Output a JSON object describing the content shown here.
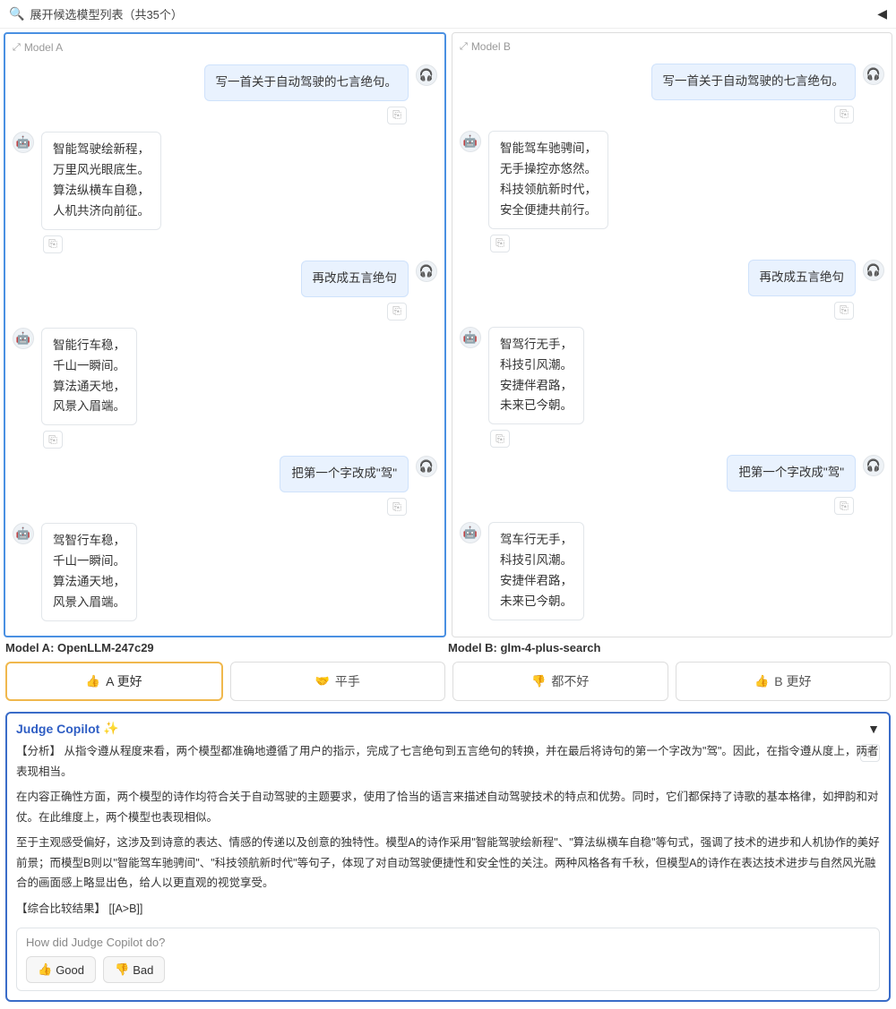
{
  "top": {
    "text": "展开候选模型列表（共35个）"
  },
  "panels": {
    "a": {
      "head": "Model A",
      "turns": [
        {
          "role": "user",
          "text": "写一首关于自动驾驶的七言绝句。"
        },
        {
          "role": "bot",
          "lines": [
            "智能驾驶绘新程，",
            "万里风光眼底生。",
            "算法纵横车自稳，",
            "人机共济向前征。"
          ]
        },
        {
          "role": "user",
          "text": "再改成五言绝句"
        },
        {
          "role": "bot",
          "lines": [
            "智能行车稳，",
            "千山一瞬间。",
            "算法通天地，",
            "风景入眉端。"
          ]
        },
        {
          "role": "user",
          "text": "把第一个字改成\"驾\""
        },
        {
          "role": "bot",
          "lines": [
            "驾智行车稳，",
            "千山一瞬间。",
            "算法通天地，",
            "风景入眉端。"
          ]
        }
      ]
    },
    "b": {
      "head": "Model B",
      "turns": [
        {
          "role": "user",
          "text": "写一首关于自动驾驶的七言绝句。"
        },
        {
          "role": "bot",
          "lines": [
            "智能驾车驰骋间，",
            "无手操控亦悠然。",
            "科技领航新时代，",
            "安全便捷共前行。"
          ]
        },
        {
          "role": "user",
          "text": "再改成五言绝句"
        },
        {
          "role": "bot",
          "lines": [
            "智驾行无手，",
            "科技引风潮。",
            "安捷伴君路，",
            "未来已今朝。"
          ]
        },
        {
          "role": "user",
          "text": "把第一个字改成\"驾\""
        },
        {
          "role": "bot",
          "lines": [
            "驾车行无手，",
            "科技引风潮。",
            "安捷伴君路，",
            "未来已今朝。"
          ]
        }
      ]
    }
  },
  "model_labels": {
    "a": "Model A: OpenLLM-247c29",
    "b": "Model B: glm-4-plus-search"
  },
  "votes": {
    "a_better": "A 更好",
    "tie": "平手",
    "both_bad": "都不好",
    "b_better": "B 更好"
  },
  "judge": {
    "title": "Judge Copilot",
    "analysis_label": "【分析】",
    "analysis_p1": "从指令遵从程度来看，两个模型都准确地遵循了用户的指示，完成了七言绝句到五言绝句的转换，并在最后将诗句的第一个字改为\"驾\"。因此，在指令遵从度上，两者表现相当。",
    "analysis_p2": "在内容正确性方面，两个模型的诗作均符合关于自动驾驶的主题要求，使用了恰当的语言来描述自动驾驶技术的特点和优势。同时，它们都保持了诗歌的基本格律，如押韵和对仗。在此维度上，两个模型也表现相似。",
    "analysis_p3": "至于主观感受偏好，这涉及到诗意的表达、情感的传递以及创意的独特性。模型A的诗作采用\"智能驾驶绘新程\"、\"算法纵横车自稳\"等句式，强调了技术的进步和人机协作的美好前景；而模型B则以\"智能驾车驰骋间\"、\"科技领航新时代\"等句子，体现了对自动驾驶便捷性和安全性的关注。两种风格各有千秋，但模型A的诗作在表达技术进步与自然风光融合的画面感上略显出色，给人以更直观的视觉享受。",
    "result_label": "【综合比较结果】",
    "result": "[[A>B]]"
  },
  "feedback": {
    "question": "How did Judge Copilot do?",
    "good": "Good",
    "bad": "Bad"
  }
}
